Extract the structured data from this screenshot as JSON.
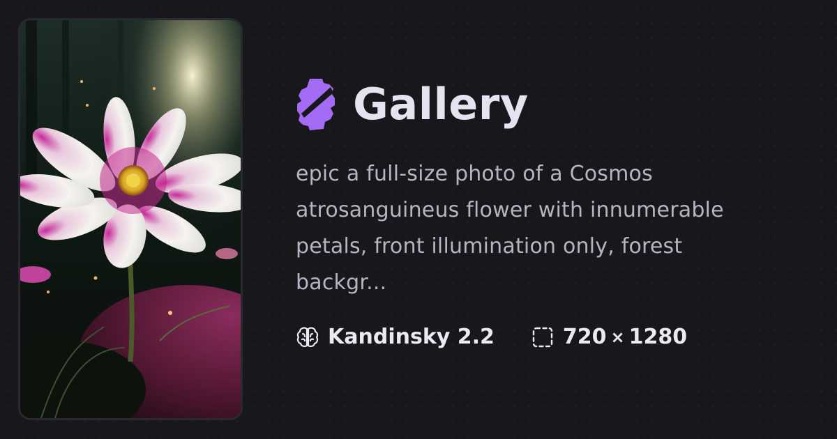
{
  "header": {
    "title": "Gallery",
    "logo_icon": "gear-lightning-logo-icon",
    "accent_color": "#a46cf4"
  },
  "preview": {
    "image_icon": "flower-photo"
  },
  "prompt": {
    "text": "epic a full-size photo of a Cosmos atrosanguineus flower with innumerable petals, front illumination only, forest backgr..."
  },
  "meta": {
    "model_icon": "brain-icon",
    "model": "Kandinsky 2.2",
    "size_icon": "dashed-frame-icon",
    "width": "720",
    "times": "×",
    "height": "1280"
  },
  "colors": {
    "background": "#18171c",
    "text_primary": "#e6e2f0",
    "text_secondary": "#b8b4c3"
  }
}
